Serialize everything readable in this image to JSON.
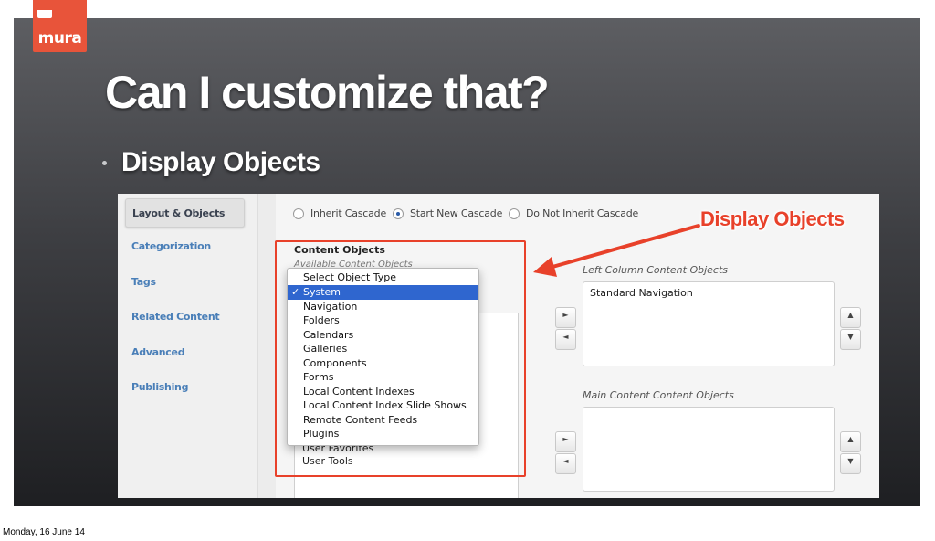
{
  "logo": {
    "text": "mura"
  },
  "slide": {
    "title": "Can I customize that?",
    "bullet": "Display Objects"
  },
  "footer": {
    "date": "Monday, 16 June 14"
  },
  "sidebar": {
    "active": "Layout & Objects",
    "items": [
      {
        "label": "Categorization"
      },
      {
        "label": "Tags"
      },
      {
        "label": "Related Content"
      },
      {
        "label": "Advanced"
      },
      {
        "label": "Publishing"
      }
    ]
  },
  "cascade": {
    "options": [
      {
        "label": "Inherit Cascade",
        "selected": false
      },
      {
        "label": "Start New Cascade",
        "selected": true
      },
      {
        "label": "Do Not Inherit Cascade",
        "selected": false
      }
    ]
  },
  "content_objects": {
    "title": "Content Objects",
    "subtitle": "Available Content Objects",
    "list_items": [
      "User Favorites",
      "User Tools"
    ]
  },
  "dropdown": {
    "items": [
      {
        "label": "Select Object Type",
        "selected": false
      },
      {
        "label": "System",
        "selected": true
      },
      {
        "label": "Navigation",
        "selected": false
      },
      {
        "label": "Folders",
        "selected": false
      },
      {
        "label": "Calendars",
        "selected": false
      },
      {
        "label": "Galleries",
        "selected": false
      },
      {
        "label": "Components",
        "selected": false
      },
      {
        "label": "Forms",
        "selected": false
      },
      {
        "label": "Local Content Indexes",
        "selected": false
      },
      {
        "label": "Local Content Index Slide Shows",
        "selected": false
      },
      {
        "label": "Remote Content Feeds",
        "selected": false
      },
      {
        "label": "Plugins",
        "selected": false
      }
    ],
    "check": "✓"
  },
  "left_column": {
    "label": "Left Column Content Objects",
    "items": [
      "Standard Navigation"
    ]
  },
  "main_column": {
    "label": "Main Content Content Objects",
    "items": []
  },
  "callout": {
    "text": "Display Objects",
    "color": "#e8412a"
  },
  "icons": {
    "right": "►",
    "left": "◄",
    "up": "▲",
    "down": "▼"
  }
}
